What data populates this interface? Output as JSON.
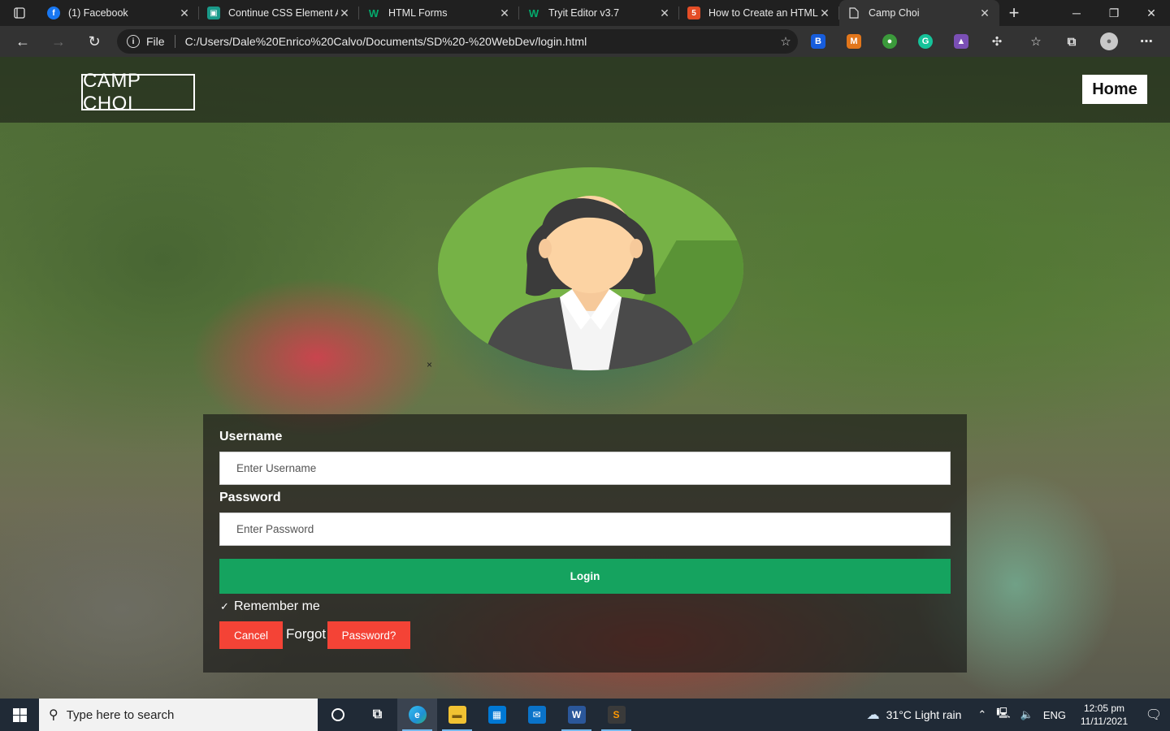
{
  "browser": {
    "tabs": [
      {
        "title": "(1) Facebook",
        "icon": "facebook-icon",
        "color": "#1877f2",
        "glyph": "f",
        "active": false
      },
      {
        "title": "Continue CSS Element A",
        "icon": "course-icon",
        "color": "#1a9a8a",
        "glyph": "▣",
        "active": false
      },
      {
        "title": "HTML Forms",
        "icon": "w3schools-icon",
        "color": "#04aa6d",
        "glyph": "W",
        "active": false
      },
      {
        "title": "Tryit Editor v3.7",
        "icon": "w3schools-icon",
        "color": "#04aa6d",
        "glyph": "W",
        "active": false
      },
      {
        "title": "How to Create an HTML",
        "icon": "html5-icon",
        "color": "#e44d26",
        "glyph": "5",
        "active": false
      },
      {
        "title": "Camp Choi",
        "icon": "file-icon",
        "color": "#333333",
        "glyph": "🗋",
        "active": true
      }
    ],
    "new_tab_glyph": "+",
    "window_controls": {
      "minimize": "─",
      "maximize": "❐",
      "close": "✕"
    },
    "address": {
      "scheme_label": "File",
      "url": "C:/Users/Dale%20Enrico%20Calvo/Documents/SD%20-%20WebDev/login.html"
    },
    "nav": {
      "back": "←",
      "forward": "→",
      "refresh": "↻"
    }
  },
  "page": {
    "logo_text": "CAMP CHOI",
    "nav_home": "Home",
    "stray_text": "×",
    "form": {
      "username_label": "Username",
      "username_placeholder": "Enter Username",
      "password_label": "Password",
      "password_placeholder": "Enter Password",
      "login_label": "Login",
      "remember_label": "Remember me",
      "remember_checked": true,
      "cancel_label": "Cancel",
      "forgot_text": "Forgot",
      "password_link_label": "Password?"
    },
    "colors": {
      "login_button": "#15a35f",
      "cancel_button": "#f44336",
      "avatar_bg": "#76b246"
    }
  },
  "taskbar": {
    "search_placeholder": "Type here to search",
    "weather": {
      "temp": "31°C",
      "condition": "Light rain"
    },
    "language": "ENG",
    "time": "12:05 pm",
    "date": "11/11/2021"
  }
}
